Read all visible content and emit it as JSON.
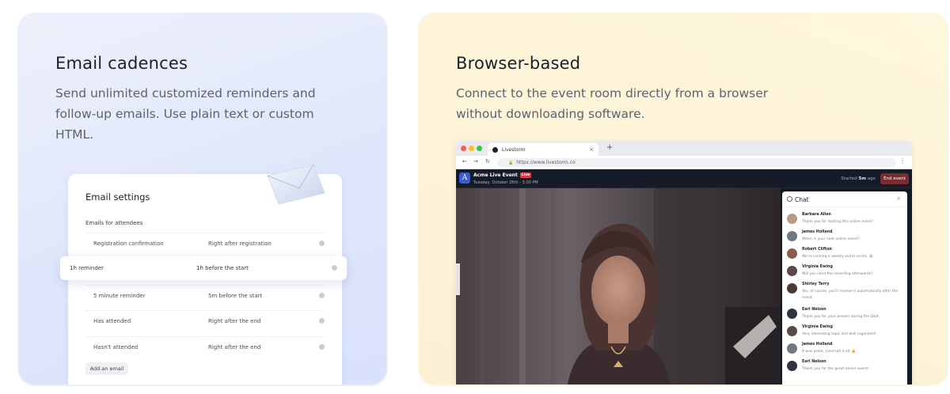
{
  "email_card": {
    "title": "Email cadences",
    "description": "Send unlimited customized reminders and follow-up emails. Use plain text or custom HTML.",
    "settings": {
      "title": "Email settings",
      "subtitle": "Emails for attendees",
      "rows": [
        {
          "name": "Registration confirmation",
          "timing": "Right after registration"
        },
        {
          "name": "1h reminder",
          "timing": "1h before the start"
        },
        {
          "name": "5 minute reminder",
          "timing": "5m before the start"
        },
        {
          "name": "Has attended",
          "timing": "Right after the end"
        },
        {
          "name": "Hasn't attended",
          "timing": "Right after the end"
        }
      ],
      "add_button": "Add an email"
    }
  },
  "browser_card": {
    "title": "Browser-based",
    "description": "Connect to the event room directly from a browser without downloading software.",
    "browser": {
      "tab_title": "Livestorm",
      "url": "https://www.livestorm.co",
      "event_title": "Acme Live Event",
      "live_badge": "Live",
      "event_date": "Tuesday, October 26th - 3:00 PM",
      "started_prefix": "Started",
      "started_value": "5m",
      "started_suffix": "ago",
      "end_button": "End event",
      "chat": {
        "title": "Chat",
        "messages": [
          {
            "name": "Barbara Allen",
            "text": "Thank you for hosting this online event!"
          },
          {
            "name": "James Holland",
            "text": "When is your next online event?"
          },
          {
            "name": "Robert Clifton",
            "text": "We're running a weekly event series. 😀"
          },
          {
            "name": "Virginia Ewing",
            "text": "Will you send the recording afterwards?"
          },
          {
            "name": "Shirley Terry",
            "text": "Yes, of course, you'll receive it automatically after the event."
          },
          {
            "name": "Earl Nelson",
            "text": "Thank you for your answer during the Q&A."
          },
          {
            "name": "Virginia Ewing",
            "text": "Very interesting topic and well organized!"
          },
          {
            "name": "James Holland",
            "text": "It was great, I learned a lot 👍"
          },
          {
            "name": "Earl Nelson",
            "text": "Thank you for the great online event!"
          }
        ]
      }
    }
  },
  "colors": {
    "left_card_bg": "#dfe6fb",
    "right_card_bg": "#fdf3d6",
    "live_red": "#e03d47",
    "end_event_bg": "#7c2b2f",
    "app_dark": "#141a24"
  }
}
